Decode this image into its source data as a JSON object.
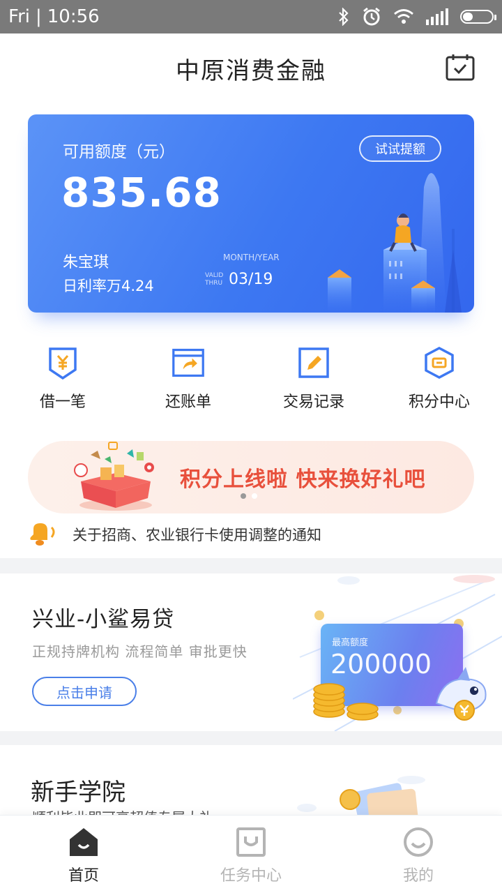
{
  "status_bar": {
    "day": "Fri",
    "time": "10:56"
  },
  "header": {
    "title": "中原消费金融"
  },
  "credit_card": {
    "label": "可用额度（元）",
    "amount": "835.68",
    "name": "朱宝琪",
    "rate": "日利率万4.24",
    "month_year_label": "MONTH/YEAR",
    "valid_label_1": "VALID",
    "valid_label_2": "THRU",
    "expiry": "03/19",
    "raise_button": "试试提额"
  },
  "quick_actions": [
    {
      "label": "借一笔",
      "icon": "yuan-shield-icon"
    },
    {
      "label": "还账单",
      "icon": "repay-window-icon"
    },
    {
      "label": "交易记录",
      "icon": "edit-record-icon"
    },
    {
      "label": "积分中心",
      "icon": "points-hexagon-icon"
    }
  ],
  "banner": {
    "text": "积分上线啦 快来换好礼吧",
    "active_dot": 0,
    "dot_count": 2
  },
  "notice": {
    "text": "关于招商、农业银行卡使用调整的通知"
  },
  "promo": {
    "title": "兴业-小鲨易贷",
    "subtitle": "正规持牌机构  流程简单  审批更快",
    "button": "点击申请",
    "card_label": "最高额度",
    "card_value": "200000"
  },
  "academy": {
    "title": "新手学院",
    "subtitle": "顺利毕业即可享超值专属大礼"
  },
  "tabs": [
    {
      "label": "首页",
      "active": true
    },
    {
      "label": "任务中心",
      "active": false
    },
    {
      "label": "我的",
      "active": false
    }
  ],
  "colors": {
    "accent": "#3d78f2",
    "orange": "#f5a623",
    "banner_red": "#e8503c",
    "tab_active": "#222222",
    "tab_inactive": "#b4b4b4"
  }
}
